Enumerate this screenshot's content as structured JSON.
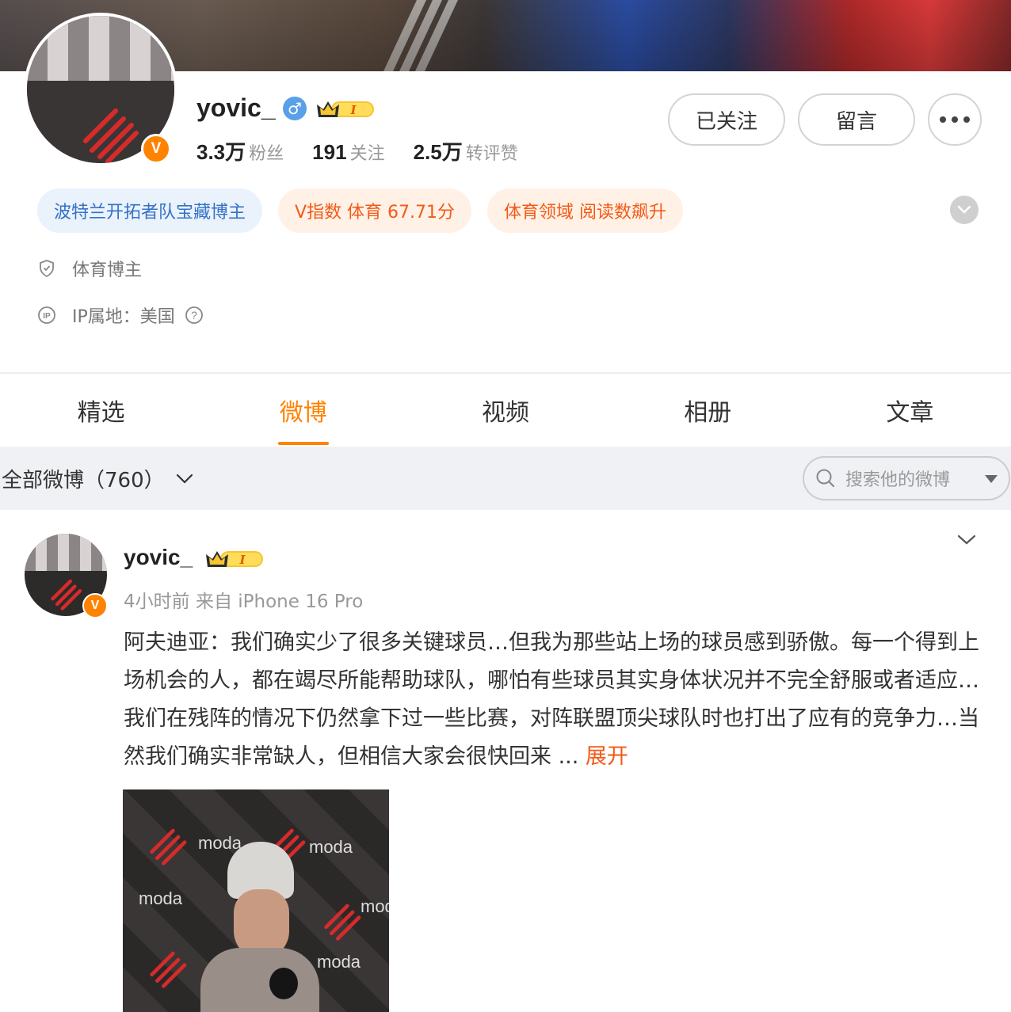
{
  "profile": {
    "name": "yovic_",
    "verified_letter": "V",
    "level_badge": "I",
    "stats": [
      {
        "value": "3.3万",
        "label": "粉丝"
      },
      {
        "value": "191",
        "label": "关注"
      },
      {
        "value": "2.5万",
        "label": "转评赞"
      }
    ],
    "buttons": {
      "follow": "已关注",
      "message": "留言"
    },
    "tags": [
      "波特兰开拓者队宝藏博主",
      "V指数 体育 67.71分",
      "体育领域 阅读数飙升"
    ],
    "category": "体育博主",
    "ip_location": "IP属地：美国"
  },
  "tabs": [
    "精选",
    "微博",
    "视频",
    "相册",
    "文章"
  ],
  "active_tab": "微博",
  "filter": {
    "label": "全部微博（760）",
    "search_placeholder": "搜索他的微博"
  },
  "post": {
    "author": "yovic_",
    "level_badge": "I",
    "verified_letter": "V",
    "meta": "4小时前  来自 iPhone 16 Pro",
    "text": "阿夫迪亚：我们确实少了很多关键球员…但我为那些站上场的球员感到骄傲。每一个得到上场机会的人，都在竭尽所能帮助球队，哪怕有些球员其实身体状况并不完全舒服或者适应…我们在残阵的情况下仍然拿下过一些比赛，对阵联盟顶尖球队时也打出了应有的竞争力…当然我们确实非常缺人，但相信大家会很快回来 ... ",
    "expand_label": "展开",
    "image_wall_text": [
      "moda",
      "moda",
      "moda",
      "moda",
      "moda",
      "moda"
    ]
  },
  "colors": {
    "accent": "#ff8200",
    "tag_blue_text": "#3571c6",
    "tag_orange_text": "#f25a16",
    "male_blue": "#5aa0e8"
  },
  "icons": {
    "male": "male-symbol-icon",
    "more": "more-dots-icon",
    "expand_tags": "chevron-down-icon",
    "category": "shield-icon",
    "ip": "ip-icon",
    "help": "question-circle-icon",
    "search": "search-icon",
    "dropdown": "caret-down-icon"
  }
}
